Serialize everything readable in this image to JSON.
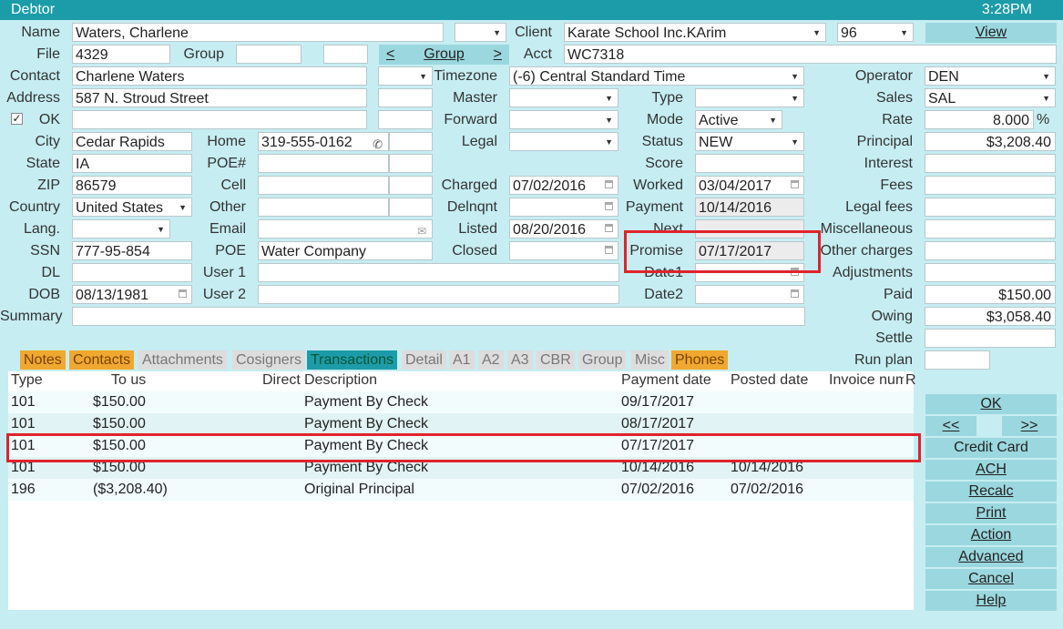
{
  "window": {
    "title": "Debtor",
    "clock": "3:28PM"
  },
  "labels": {
    "name": "Name",
    "file": "File",
    "group": "Group",
    "contact": "Contact",
    "address": "Address",
    "ok": "OK",
    "city": "City",
    "state": "State",
    "zip": "ZIP",
    "country": "Country",
    "lang": "Lang.",
    "ssn": "SSN",
    "dl": "DL",
    "dob": "DOB",
    "summary": "Summary",
    "home": "Home",
    "poe_num": "POE#",
    "cell": "Cell",
    "other": "Other",
    "email": "Email",
    "poe": "POE",
    "user1": "User 1",
    "user2": "User 2",
    "client": "Client",
    "acct": "Acct",
    "timezone": "Timezone",
    "master": "Master",
    "forward": "Forward",
    "legal": "Legal",
    "charged": "Charged",
    "delnqnt": "Delnqnt",
    "listed": "Listed",
    "closed": "Closed",
    "type": "Type",
    "mode": "Mode",
    "status": "Status",
    "score": "Score",
    "worked": "Worked",
    "payment": "Payment",
    "next": "Next",
    "promise": "Promise",
    "date1": "Date1",
    "date2": "Date2",
    "operator": "Operator",
    "sales": "Sales",
    "rate": "Rate",
    "percent": "%",
    "principal": "Principal",
    "interest": "Interest",
    "fees": "Fees",
    "legal_fees": "Legal fees",
    "misc": "Miscellaneous",
    "other_charges": "Other charges",
    "adjustments": "Adjustments",
    "paid": "Paid",
    "owing": "Owing",
    "settle": "Settle",
    "run_plan": "Run plan"
  },
  "values": {
    "name": "Waters, Charlene",
    "file": "4329",
    "contact": "Charlene Waters",
    "address": "587 N. Stroud Street",
    "city": "Cedar Rapids",
    "state": "IA",
    "zip": "86579",
    "country": "United States",
    "ssn": "777-95-854",
    "dob": "08/13/1981",
    "home": "319-555-0162",
    "poe": "Water Company",
    "client": "Karate School Inc.KArim",
    "client_num": "96",
    "acct": "WC7318",
    "timezone": "(-6) Central Standard Time",
    "charged": "07/02/2016",
    "listed": "08/20/2016",
    "mode": "Active",
    "status": "NEW",
    "worked": "03/04/2017",
    "payment": "10/14/2016",
    "promise": "07/17/2017",
    "operator": "DEN",
    "sales": "SAL",
    "rate": "8.000",
    "principal": "$3,208.40",
    "paid": "$150.00",
    "owing": "$3,058.40"
  },
  "buttons": {
    "view": "View",
    "group_prev": "<",
    "group": "Group",
    "group_next": ">",
    "ok": "OK",
    "prev": "<<",
    "next": ">>",
    "credit_card": "Credit Card",
    "ach": "ACH",
    "recalc": "Recalc",
    "print": "Print",
    "action": "Action",
    "advanced": "Advanced",
    "cancel": "Cancel",
    "help": "Help"
  },
  "tabs": [
    "Notes",
    "Contacts",
    "Attachments",
    "Cosigners",
    "Transactions",
    "Detail",
    "A1",
    "A2",
    "A3",
    "CBR",
    "Group",
    "Misc",
    "Phones"
  ],
  "table": {
    "headers": {
      "type": "Type",
      "to_us": "To us",
      "direct": "Direct",
      "description": "Description",
      "payment_date": "Payment date",
      "posted_date": "Posted date",
      "invoice": "Invoice num",
      "r": "R"
    },
    "rows": [
      {
        "type": "101",
        "to_us": "$150.00",
        "description": "Payment By Check",
        "payment_date": "09/17/2017",
        "posted_date": ""
      },
      {
        "type": "101",
        "to_us": "$150.00",
        "description": "Payment By Check",
        "payment_date": "08/17/2017",
        "posted_date": ""
      },
      {
        "type": "101",
        "to_us": "$150.00",
        "description": "Payment By Check",
        "payment_date": "07/17/2017",
        "posted_date": ""
      },
      {
        "type": "101",
        "to_us": "$150.00",
        "description": "Payment By Check",
        "payment_date": "10/14/2016",
        "posted_date": "10/14/2016"
      },
      {
        "type": "196",
        "to_us": "($3,208.40)",
        "description": "Original Principal",
        "payment_date": "07/02/2016",
        "posted_date": "07/02/2016"
      }
    ]
  },
  "colors": {
    "titlebar": "#1c9ca8",
    "background": "#c6edf2",
    "button": "#9bd7de",
    "highlight": "#e0232b",
    "tab_orange": "#f0a830"
  }
}
